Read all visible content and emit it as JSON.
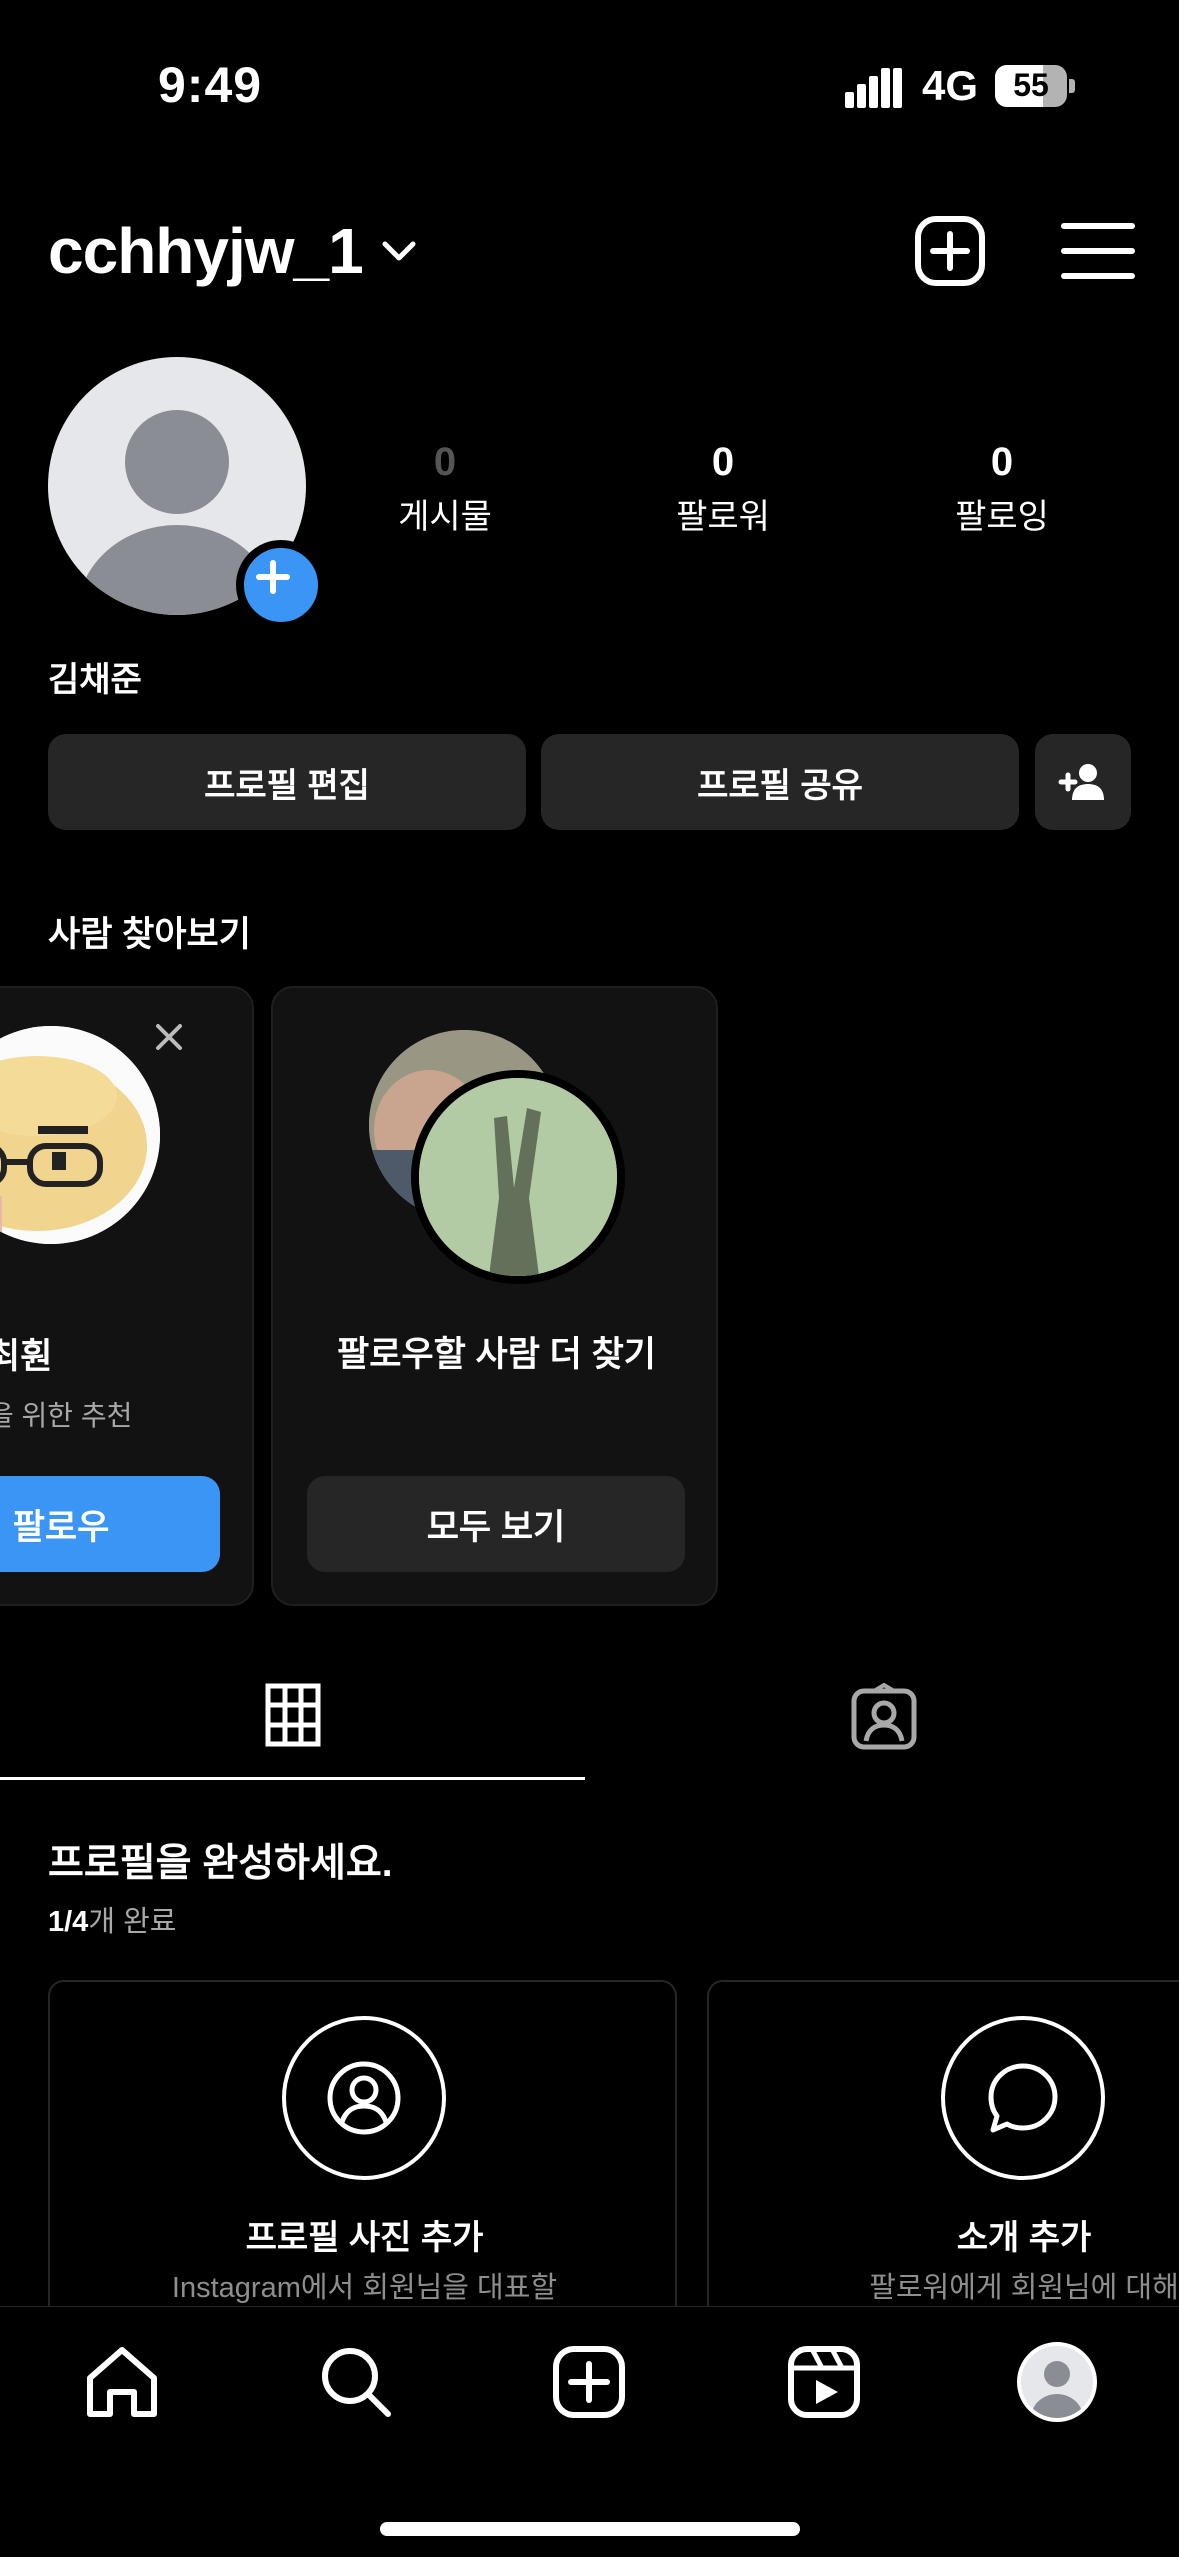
{
  "status_bar": {
    "time": "9:49",
    "network": "4G",
    "battery": "55"
  },
  "header": {
    "username": "cchhyjw_1"
  },
  "profile": {
    "stats": [
      {
        "value": "0",
        "label": "게시물"
      },
      {
        "value": "0",
        "label": "팔로워"
      },
      {
        "value": "0",
        "label": "팔로잉"
      }
    ],
    "full_name": "김채준",
    "buttons": {
      "edit": "프로필 편집",
      "share": "프로필 공유"
    }
  },
  "discover": {
    "title": "사람 찾아보기",
    "card1": {
      "name": "최훤",
      "subtitle": "을 위한 추천",
      "button": "팔로우"
    },
    "card2": {
      "title": "팔로우할 사람 더 찾기",
      "button": "모두 보기"
    }
  },
  "complete_profile": {
    "title": "프로필을 완성하세요.",
    "progress_strong": "1/4",
    "progress_rest": "개 완료",
    "cards": [
      {
        "title": "프로필 사진 추가",
        "desc": "Instagram에서 회원님을 대표할"
      },
      {
        "title": "소개 추가",
        "desc": "팔로워에게 회원님에 대해"
      }
    ]
  },
  "colors": {
    "accent": "#3a95f4",
    "button_bg": "#262626",
    "card_bg": "#121212"
  }
}
